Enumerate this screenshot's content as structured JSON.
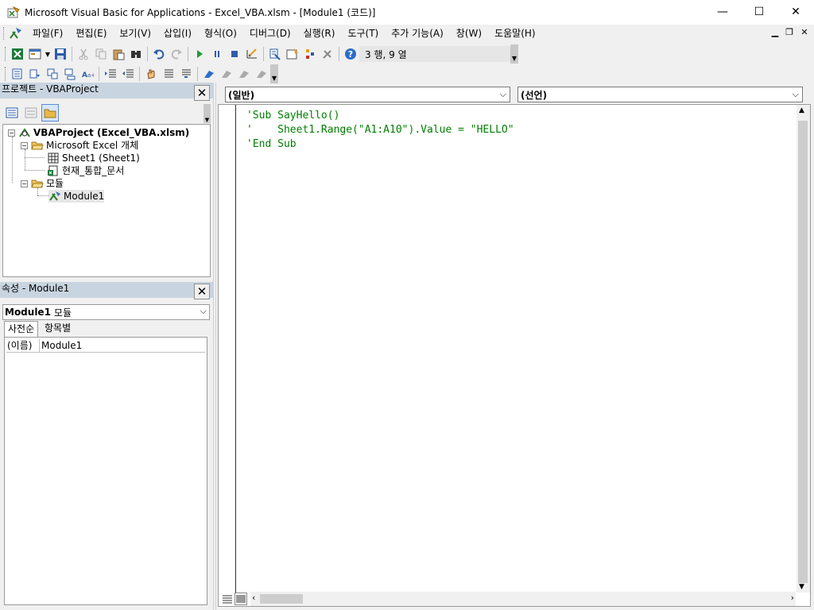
{
  "window": {
    "title": "Microsoft Visual Basic for Applications - Excel_VBA.xlsm - [Module1 (코드)]",
    "minimize": "—",
    "maximize": "☐",
    "close": "✕"
  },
  "menu": {
    "items": [
      "파일(F)",
      "편집(E)",
      "보기(V)",
      "삽입(I)",
      "형식(O)",
      "디버그(D)",
      "실행(R)",
      "도구(T)",
      "추가 기능(A)",
      "창(W)",
      "도움말(H)"
    ],
    "mdi_minimize": "▁",
    "mdi_restore": "❐",
    "mdi_close": "✕"
  },
  "toolbar": {
    "status": "3 행, 9 열"
  },
  "project_pane": {
    "title": "프로젝트 - VBAProject",
    "close": "✕",
    "tree": {
      "root": "VBAProject (Excel_VBA.xlsm)",
      "excel_objects": "Microsoft Excel 개체",
      "sheet1": "Sheet1 (Sheet1)",
      "workbook": "현재_통합_문서",
      "modules_folder": "모듈",
      "module1": "Module1"
    }
  },
  "properties_pane": {
    "title": "속성 - Module1",
    "close": "✕",
    "object_name": "Module1",
    "object_type": "모듈",
    "tabs": [
      "사전순",
      "항목별"
    ],
    "rows": [
      {
        "key": "(이름)",
        "value": "Module1"
      }
    ]
  },
  "code_window": {
    "object_combo": "(일반)",
    "procedure_combo": "(선언)",
    "lines": [
      "'Sub SayHello()",
      "'    Sheet1.Range(\"A1:A10\").Value = \"HELLO\"",
      "'End Sub"
    ]
  },
  "colors": {
    "comment": "#007f00",
    "pane_title": "#c8d4e0",
    "accent_blue": "#1e6fd9"
  }
}
